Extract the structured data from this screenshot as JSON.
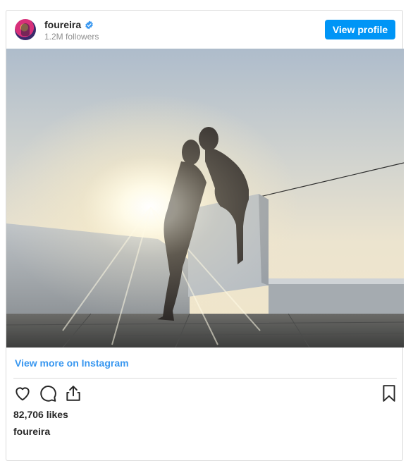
{
  "post": {
    "username": "foureira",
    "followers": "1.2M followers",
    "view_profile_label": "View profile",
    "view_more_label": "View more on Instagram",
    "likes": "82,706 likes",
    "caption_username": "foureira"
  },
  "icons": {
    "verified": "verified-badge-icon",
    "like": "heart-icon",
    "comment": "comment-icon",
    "share": "share-icon",
    "save": "bookmark-icon"
  },
  "colors": {
    "accent_button": "#0095f6",
    "link": "#3897f0",
    "border": "#dbdbdb",
    "muted_text": "#8e8e8e"
  }
}
